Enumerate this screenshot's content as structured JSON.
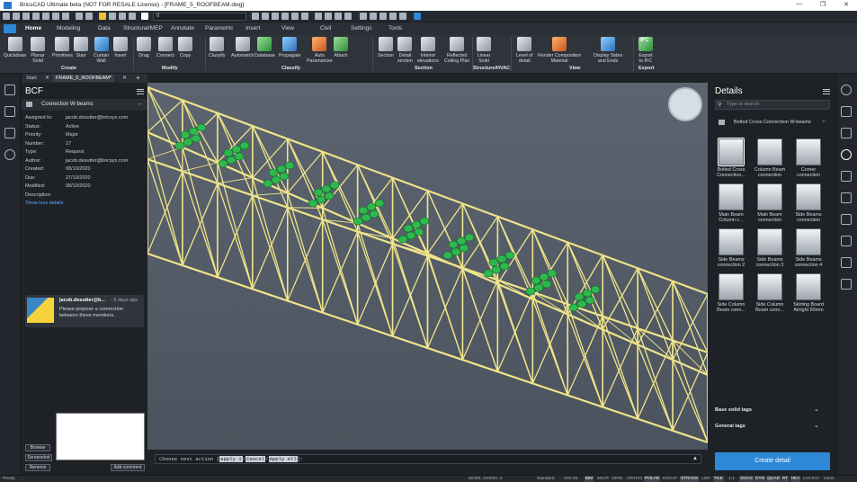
{
  "window": {
    "title": "BricsCAD Ultimate beta (NOT FOR RESALE License) - [FRAME_5_ROOFBEAM.dwg]",
    "controls": [
      "—",
      "❐",
      "✕"
    ]
  },
  "quick_access": {
    "layer_value": "0"
  },
  "menu_tabs": [
    "Home",
    "Modeling",
    "Data",
    "Structural/MEP",
    "Annotate",
    "Parametric",
    "Insert",
    "View",
    "Civil",
    "Settings",
    "Tools"
  ],
  "ribbon": {
    "buttons": [
      {
        "label": "Quickdraw",
        "color": ""
      },
      {
        "label": "Planar\nSolid",
        "color": ""
      },
      {
        "label": "Primitives",
        "color": ""
      },
      {
        "label": "Stair",
        "color": ""
      },
      {
        "label": "Curtain\nWall",
        "color": "bl"
      },
      {
        "label": "Insert",
        "color": ""
      },
      {
        "label": "Drag",
        "color": ""
      },
      {
        "label": "Connect",
        "color": ""
      },
      {
        "label": "Copy",
        "color": ""
      },
      {
        "label": "Classify",
        "color": ""
      },
      {
        "label": "Automatch",
        "color": ""
      },
      {
        "label": "Database",
        "color": "gr"
      },
      {
        "label": "Propagate",
        "color": "bl"
      },
      {
        "label": "Auto\nParametrize",
        "color": "or"
      },
      {
        "label": "Attach",
        "color": "gr"
      },
      {
        "label": "Section",
        "color": ""
      },
      {
        "label": "Detail\nsection",
        "color": ""
      },
      {
        "label": "Interior\nelevations",
        "color": ""
      },
      {
        "label": "Reflected\nCeiling Plan",
        "color": ""
      },
      {
        "label": "Linear\nSolid",
        "color": ""
      },
      {
        "label": "Level of\ndetail",
        "color": ""
      },
      {
        "label": "Render Composition\nMaterial",
        "color": "or"
      },
      {
        "label": "Display Sides\nand Ends",
        "color": "bl"
      },
      {
        "label": "Export\nto IFC",
        "color": "gr"
      }
    ],
    "groups": [
      "Create",
      "Modify",
      "Classify",
      "Section",
      "Structure/HVAC",
      "View",
      "Export"
    ],
    "ifc_label": "IFC"
  },
  "doc_tabs": [
    "Start",
    "FRAME_5_ROOFBEAM*"
  ],
  "bcf": {
    "title": "BCF",
    "topic": "Connection W-beams",
    "fields": [
      {
        "label": "Assigned to:",
        "value": "jacob.desutter@bricsys.com"
      },
      {
        "label": "Status:",
        "value": "Active"
      },
      {
        "label": "Priority:",
        "value": "Major"
      },
      {
        "label": "Number:",
        "value": "17"
      },
      {
        "label": "Type:",
        "value": "Request"
      },
      {
        "label": "Author:",
        "value": "jacob.desutter@bricsys.com"
      },
      {
        "label": "Created:",
        "value": "08/10/2020"
      },
      {
        "label": "Due:",
        "value": "27/10/2020"
      },
      {
        "label": "Modified:",
        "value": "08/10/2020"
      },
      {
        "label": "Description:",
        "value": ""
      }
    ],
    "show_less": "Show less details",
    "comment": {
      "author": "jacob.desutter@b...",
      "time": "- 5 days ago",
      "text": "Please propose a connection between these members."
    },
    "buttons": {
      "browse": "Browse",
      "screenshot": "Screenshot",
      "remove": "Remove",
      "add_comment": "Add comment"
    }
  },
  "command_line": {
    "prompt": "Choose next action ",
    "opt1": "apply 1",
    "opt2": "Cancel",
    "opt3": "Apply All",
    "close": "]:"
  },
  "details": {
    "title": "Details",
    "search_placeholder": "Type to search",
    "breadcrumb": "Bolted Cross Connection W-beams",
    "items": [
      "Bolted Cross\nConnection...",
      "Column Beam\nconnection",
      "Corner\nconnection",
      "Main Beam\nColumn c...",
      "Main Beam\nconnection",
      "Side Beams\nconnection",
      "Side Beams\nconnection 2",
      "Side Beams\nconnection 3",
      "Side Beams\nconnection 4",
      "Side Column\nBeam conn...",
      "Side Column\nBeam conn...",
      "Skirting Board\nAirtight 60mm"
    ],
    "sections": [
      "Base solid tags",
      "General tags"
    ],
    "create_button": "Create detail"
  },
  "status_bar": {
    "left": "Ready",
    "coords": "82300, 234200, 0",
    "items": [
      "Standard",
      "ISO-25",
      "BIM",
      "SNAP",
      "GRID",
      "ORTHO",
      "POLAR",
      "ESNAP",
      "STRACK",
      "LWT",
      "TILE",
      "1:1",
      "DUCS",
      "DYN",
      "QUAD",
      "RT",
      "HKA",
      "LOCKUI",
      "None"
    ],
    "on": [
      "BIM",
      "POLAR",
      "STRACK",
      "TILE",
      "DUCS",
      "DYN",
      "QUAD",
      "RT",
      "HKA"
    ]
  },
  "colors": {
    "truss": "#efe48a",
    "connection": "#2fb84f",
    "accent": "#2e88d8"
  }
}
